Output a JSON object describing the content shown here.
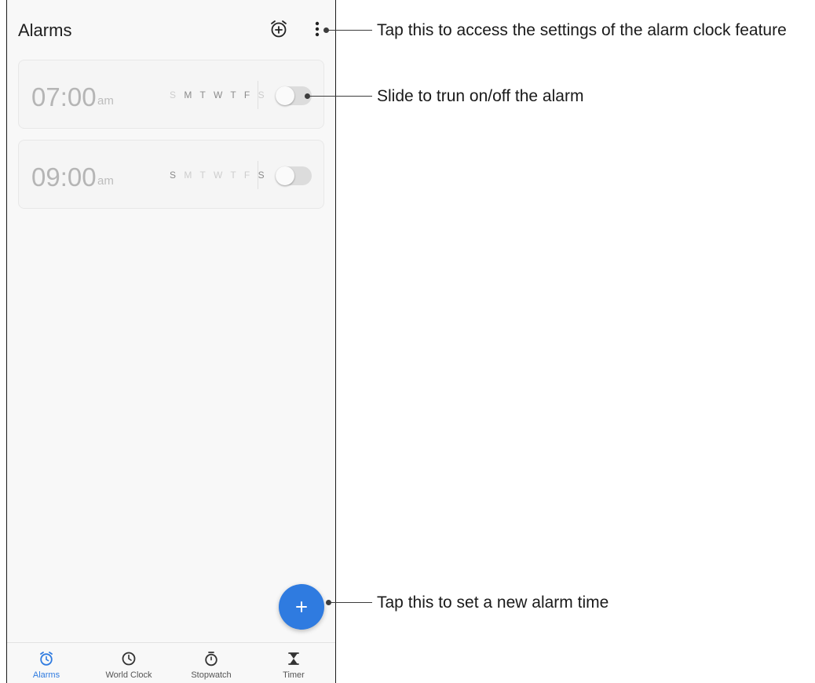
{
  "header": {
    "title": "Alarms",
    "add_alarm_icon": "alarm-add-icon",
    "menu_icon": "more-vert-icon"
  },
  "alarms": [
    {
      "time": "07:00",
      "ampm": "am",
      "days": [
        {
          "letter": "S",
          "active": false
        },
        {
          "letter": "M",
          "active": true
        },
        {
          "letter": "T",
          "active": true
        },
        {
          "letter": "W",
          "active": true
        },
        {
          "letter": "T",
          "active": true
        },
        {
          "letter": "F",
          "active": true
        },
        {
          "letter": "S",
          "active": false
        }
      ],
      "enabled": false
    },
    {
      "time": "09:00",
      "ampm": "am",
      "days": [
        {
          "letter": "S",
          "active": true
        },
        {
          "letter": "M",
          "active": false
        },
        {
          "letter": "T",
          "active": false
        },
        {
          "letter": "W",
          "active": false
        },
        {
          "letter": "T",
          "active": false
        },
        {
          "letter": "F",
          "active": false
        },
        {
          "letter": "S",
          "active": true
        }
      ],
      "enabled": false
    }
  ],
  "fab": {
    "icon": "plus-icon"
  },
  "nav": {
    "items": [
      {
        "label": "Alarms",
        "icon": "alarm-icon",
        "active": true
      },
      {
        "label": "World Clock",
        "icon": "clock-icon",
        "active": false
      },
      {
        "label": "Stopwatch",
        "icon": "stopwatch-icon",
        "active": false
      },
      {
        "label": "Timer",
        "icon": "hourglass-icon",
        "active": false
      }
    ]
  },
  "callouts": {
    "menu": "Tap this to access the settings of the alarm clock feature",
    "toggle": "Slide to trun on/off the alarm",
    "fab": "Tap this to set a new alarm time"
  },
  "colors": {
    "accent": "#2f7be0",
    "card_bg": "#f5f5f5",
    "inactive_text": "#b5b5b5"
  }
}
